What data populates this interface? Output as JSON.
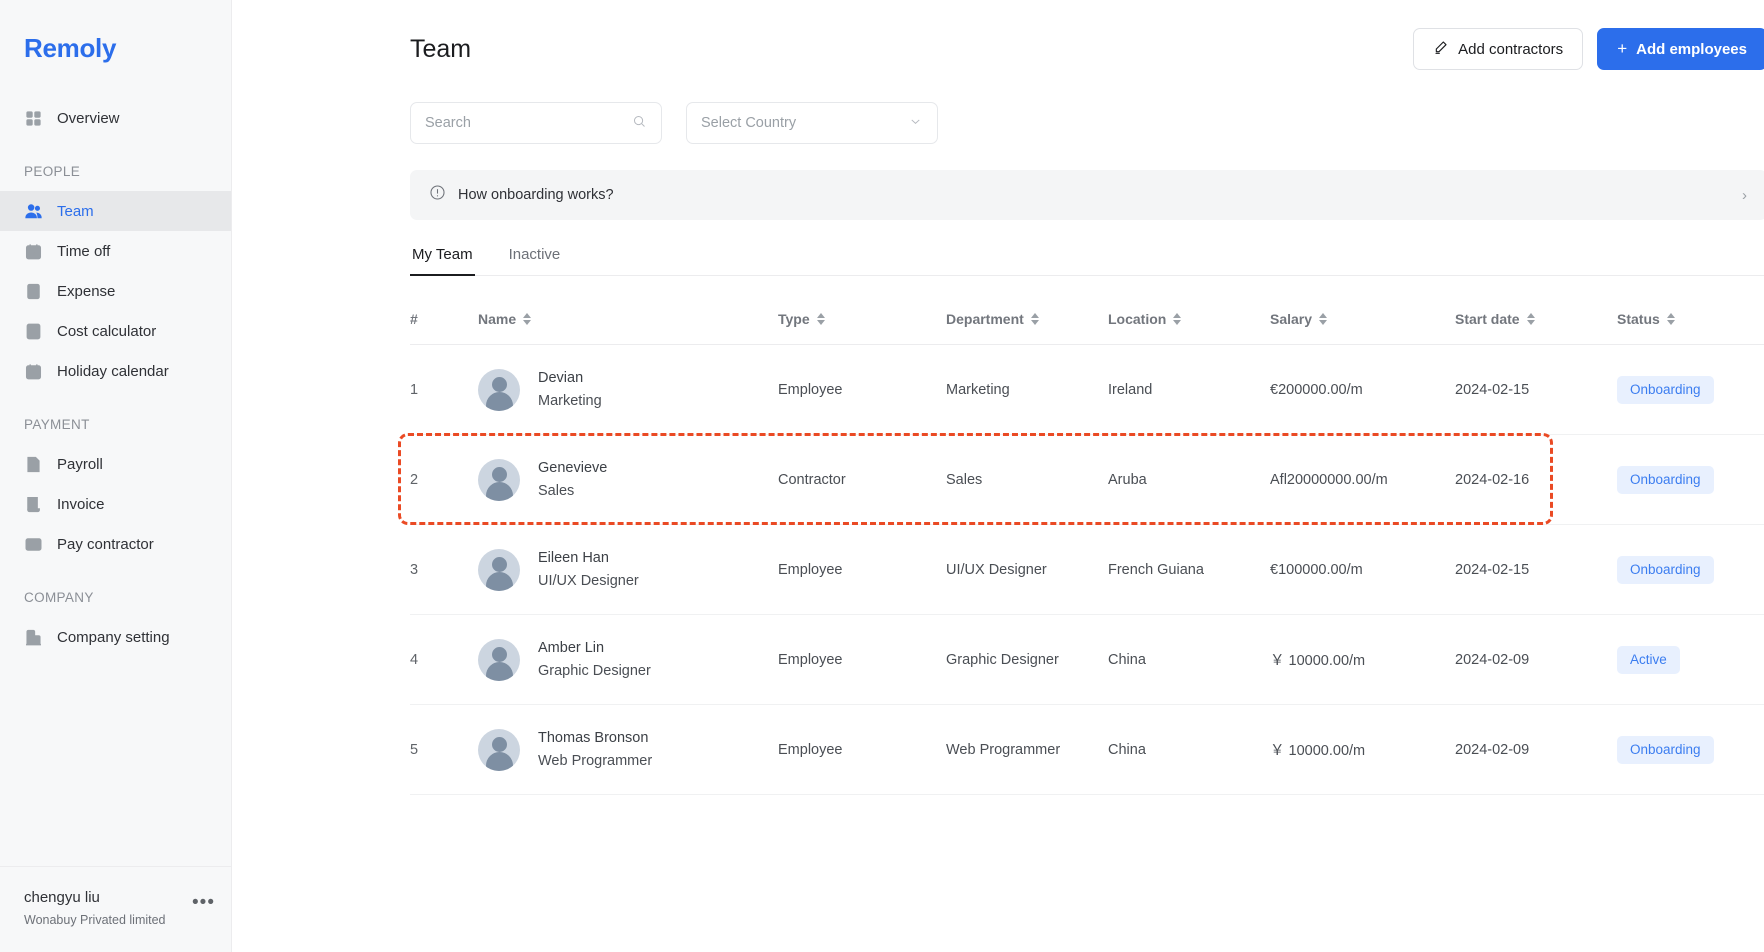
{
  "brand": {
    "name": "Remoly"
  },
  "sidebar": {
    "top_items": [
      {
        "label": "Overview",
        "icon": "grid-icon",
        "active": false
      }
    ],
    "groups": [
      {
        "label": "PEOPLE",
        "items": [
          {
            "label": "Team",
            "icon": "people-icon",
            "active": true
          },
          {
            "label": "Time off",
            "icon": "calendar-check-icon",
            "active": false
          },
          {
            "label": "Expense",
            "icon": "receipt-icon",
            "active": false
          },
          {
            "label": "Cost calculator",
            "icon": "calculator-icon",
            "active": false
          },
          {
            "label": "Holiday calendar",
            "icon": "calendar-icon",
            "active": false
          }
        ]
      },
      {
        "label": "PAYMENT",
        "items": [
          {
            "label": "Payroll",
            "icon": "document-list-icon",
            "active": false
          },
          {
            "label": "Invoice",
            "icon": "invoice-icon",
            "active": false
          },
          {
            "label": "Pay contractor",
            "icon": "credit-card-icon",
            "active": false
          }
        ]
      },
      {
        "label": "COMPANY",
        "items": [
          {
            "label": "Company setting",
            "icon": "building-icon",
            "active": false
          }
        ]
      }
    ],
    "footer": {
      "user_name": "chengyu liu",
      "organization": "Wonabuy Privated limited",
      "more_glyph": "•••"
    }
  },
  "header": {
    "title": "Team",
    "add_contractors_label": "Add contractors",
    "add_employees_label": "Add employees",
    "add_employees_plus": "+"
  },
  "filters": {
    "search_placeholder": "Search",
    "search_value": "",
    "country_placeholder": "Select Country",
    "country_value": "Select Country"
  },
  "banner": {
    "text": "How onboarding works?",
    "chevron": "›"
  },
  "tabs": [
    {
      "label": "My Team",
      "active": true
    },
    {
      "label": "Inactive",
      "active": false
    }
  ],
  "table": {
    "columns": [
      {
        "label": "#",
        "sortable": false
      },
      {
        "label": "Name",
        "sortable": true
      },
      {
        "label": "Type",
        "sortable": true
      },
      {
        "label": "Department",
        "sortable": true
      },
      {
        "label": "Location",
        "sortable": true
      },
      {
        "label": "Salary",
        "sortable": true
      },
      {
        "label": "Start date",
        "sortable": true
      },
      {
        "label": "Status",
        "sortable": true
      }
    ],
    "rows": [
      {
        "index": "1",
        "name": "Devian",
        "role": "Marketing",
        "type": "Employee",
        "department": "Marketing",
        "location": "Ireland",
        "salary": "€200000.00/m",
        "start_date": "2024-02-15",
        "status": "Onboarding",
        "highlighted": false
      },
      {
        "index": "2",
        "name": "Genevieve",
        "role": "Sales",
        "type": "Contractor",
        "department": "Sales",
        "location": "Aruba",
        "salary": "Afl20000000.00/m",
        "start_date": "2024-02-16",
        "status": "Onboarding",
        "highlighted": true
      },
      {
        "index": "3",
        "name": "Eileen Han",
        "role": "UI/UX Designer",
        "type": "Employee",
        "department": "UI/UX Designer",
        "location": "French Guiana",
        "salary": "€100000.00/m",
        "start_date": "2024-02-15",
        "status": "Onboarding",
        "highlighted": false
      },
      {
        "index": "4",
        "name": "Amber Lin",
        "role": "Graphic Designer",
        "type": "Employee",
        "department": "Graphic Designer",
        "location": "China",
        "salary": "￥ 10000.00/m",
        "start_date": "2024-02-09",
        "status": "Active",
        "highlighted": false
      },
      {
        "index": "5",
        "name": "Thomas Bronson",
        "role": "Web Programmer",
        "type": "Employee",
        "department": "Web Programmer",
        "location": "China",
        "salary": "￥ 10000.00/m",
        "start_date": "2024-02-09",
        "status": "Onboarding",
        "highlighted": false
      }
    ]
  },
  "colors": {
    "accent": "#2c6eeb",
    "sidebar_bg": "#f7f8f9",
    "sidebar_active_bg": "#e7e8ea",
    "badge_bg": "#e8f0fe",
    "badge_text": "#3b7df0",
    "highlight_outline": "#ea4a24"
  }
}
